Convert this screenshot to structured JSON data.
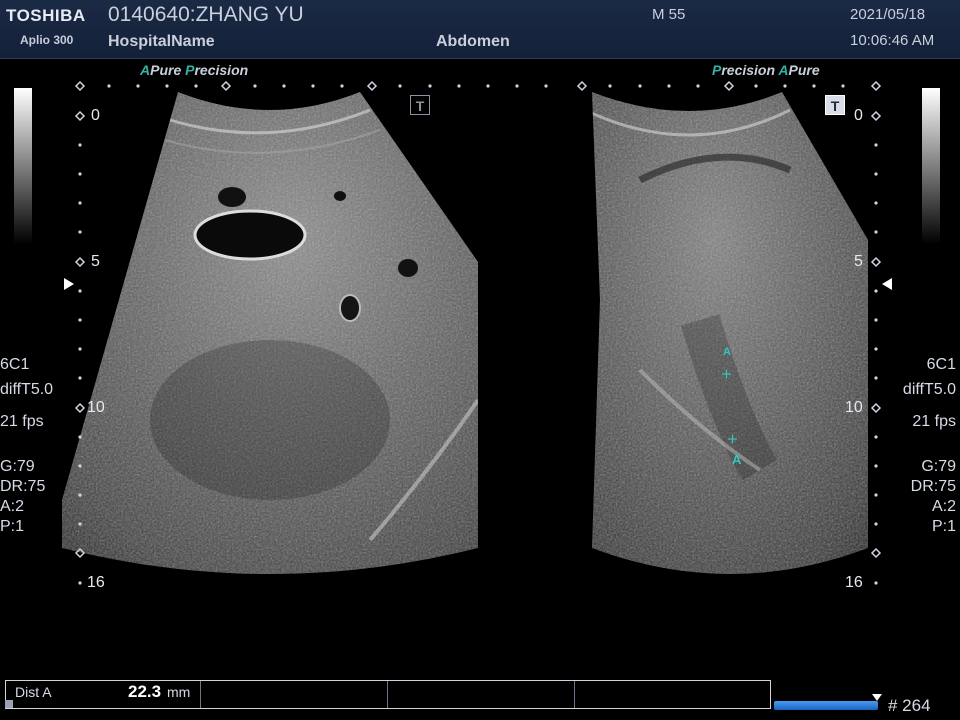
{
  "header": {
    "brand": "TOSHIBA",
    "model": "Aplio 300",
    "patient": "0140640:ZHANG YU",
    "hospital": "HospitalName",
    "gender_age": "M 55",
    "exam": "Abdomen",
    "date": "2021/05/18",
    "time": "10:06:46 AM"
  },
  "left_panel": {
    "mode_a": "A",
    "mode_pure": "Pure",
    "mode_p": "P",
    "mode_precision": "recision",
    "depth_labels": [
      "0",
      "5",
      "10",
      "16"
    ],
    "probe": "6C1",
    "filter": "diffT5.0",
    "fps": "21 fps",
    "gain": "G:79",
    "dynamic_range": "DR:75",
    "acoustic": "A:2",
    "persistence": "P:1",
    "t_icon": "T"
  },
  "right_panel": {
    "mode_p": "P",
    "mode_precision": "recision",
    "mode_a": "A",
    "mode_pure": "Pure",
    "depth_labels": [
      "0",
      "5",
      "10",
      "16"
    ],
    "probe": "6C1",
    "filter": "diffT5.0",
    "fps": "21 fps",
    "gain": "G:79",
    "dynamic_range": "DR:75",
    "acoustic": "A:2",
    "persistence": "P:1",
    "t_icon": "T",
    "caliper_label": "A"
  },
  "measurement": {
    "name": "Dist A",
    "value": "22.3",
    "unit": "mm"
  },
  "cine": {
    "frame_label": "# 264"
  },
  "colors": {
    "header_bg": "#1b2a45",
    "accent_teal": "#2fb3a6",
    "caliper": "#35c6c2",
    "cine_bar": "#2f80e0"
  }
}
